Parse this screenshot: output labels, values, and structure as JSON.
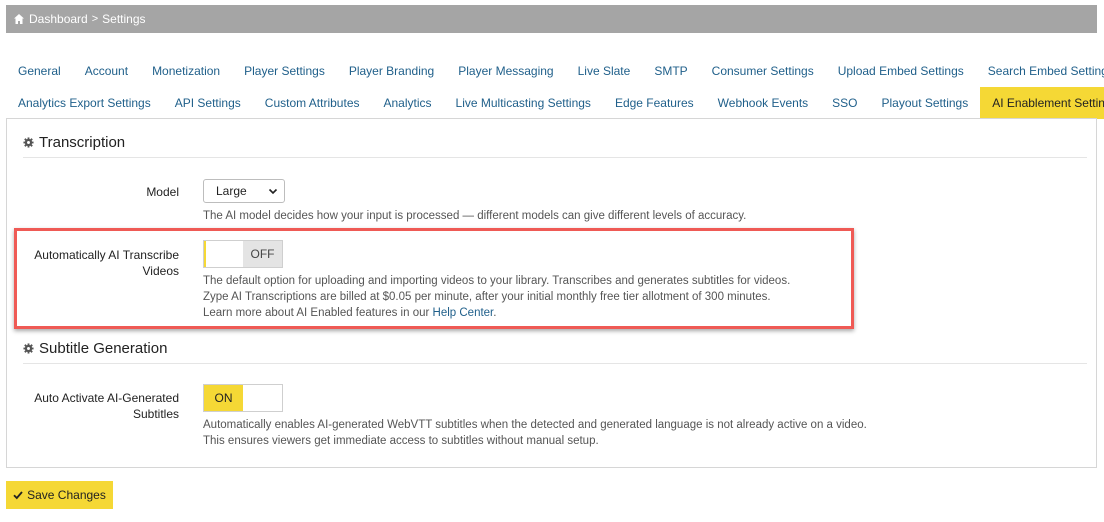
{
  "breadcrumb": {
    "home": "Dashboard",
    "separator": ">",
    "current": "Settings"
  },
  "tabs_row1": [
    "General",
    "Account",
    "Monetization",
    "Player Settings",
    "Player Branding",
    "Player Messaging",
    "Live Slate",
    "SMTP",
    "Consumer Settings",
    "Upload Embed Settings",
    "Search Embed Settings"
  ],
  "tabs_row2": [
    "Analytics Export Settings",
    "API Settings",
    "Custom Attributes",
    "Analytics",
    "Live Multicasting Settings",
    "Edge Features",
    "Webhook Events",
    "SSO",
    "Playout Settings",
    "AI Enablement Settings"
  ],
  "active_tab": "AI Enablement Settings",
  "transcription": {
    "title": "Transcription",
    "model_label": "Model",
    "model_value": "Large",
    "model_help": "The AI model decides how your input is processed — different models can give different levels of accuracy.",
    "auto_label_1": "Automatically AI Transcribe",
    "auto_label_2": "Videos",
    "auto_state": "OFF",
    "auto_help_1": "The default option for uploading and importing videos to your library. Transcribes and generates subtitles for videos.",
    "auto_help_2": "Zype AI Transcriptions are billed at $0.05 per minute, after your initial monthly free tier allotment of 300 minutes.",
    "auto_help_3_prefix": "Learn more about AI Enabled features in our ",
    "auto_help_3_link": "Help Center",
    "auto_help_3_suffix": "."
  },
  "subtitles": {
    "title": "Subtitle Generation",
    "auto_label_1": "Auto Activate AI-Generated",
    "auto_label_2": "Subtitles",
    "auto_state": "ON",
    "help_1": "Automatically enables AI-generated WebVTT subtitles when the detected and generated language is not already active on a video.",
    "help_2": "This ensures viewers get immediate access to subtitles without manual setup."
  },
  "save_label": "Save Changes",
  "colors": {
    "accent": "#f5d835",
    "link": "#1f5f8a",
    "highlight": "#ef5a55",
    "topbar": "#a5a5a5"
  }
}
